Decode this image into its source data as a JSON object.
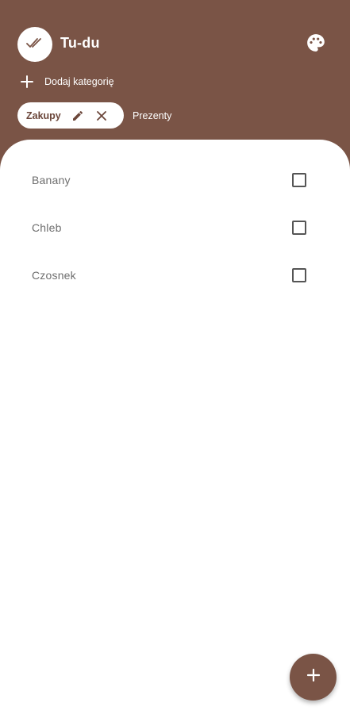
{
  "header": {
    "title": "Tu-du",
    "logo_icon": "double-check-icon",
    "theme_icon": "palette-icon"
  },
  "add_category": {
    "label": "Dodaj kategorię",
    "icon": "plus-icon"
  },
  "categories": [
    {
      "label": "Zakupy",
      "selected": true
    },
    {
      "label": "Prezenty",
      "selected": false
    }
  ],
  "items": [
    {
      "label": "Banany",
      "checked": false
    },
    {
      "label": "Chleb",
      "checked": false
    },
    {
      "label": "Czosnek",
      "checked": false
    }
  ],
  "fab": {
    "icon": "plus-icon"
  },
  "colors": {
    "primary": "#7a5446",
    "surface": "#ffffff",
    "item_text": "#6e6e6e"
  }
}
